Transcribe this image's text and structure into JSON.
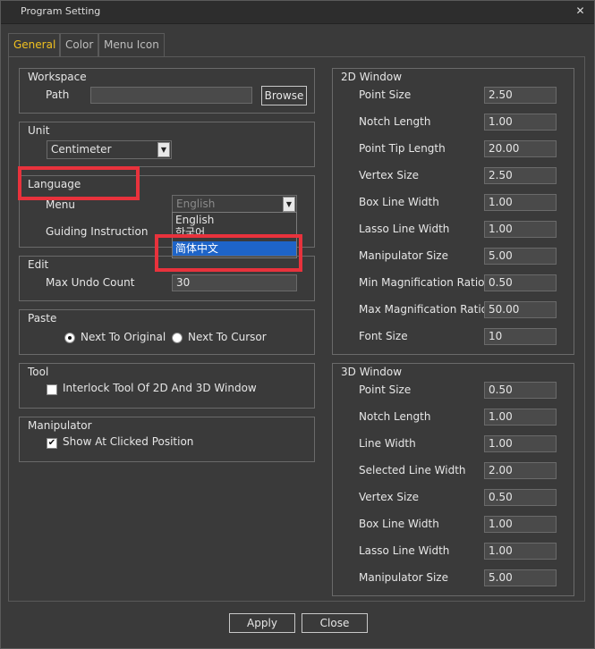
{
  "window": {
    "title": "Program Setting",
    "close_glyph": "✕"
  },
  "tabs": [
    {
      "label": "General",
      "active": true
    },
    {
      "label": "Color",
      "active": false
    },
    {
      "label": "Menu Icon",
      "active": false
    }
  ],
  "workspace": {
    "title": "Workspace",
    "path_label": "Path",
    "path_value": "",
    "browse_label": "Browse"
  },
  "unit": {
    "title": "Unit",
    "selected": "Centimeter"
  },
  "language": {
    "title": "Language",
    "menu_label": "Menu",
    "menu_selected": "English",
    "guiding_label": "Guiding Instruction",
    "dropdown_options": [
      "English",
      "한국어",
      "简体中文"
    ],
    "dropdown_selected_index": 2
  },
  "edit": {
    "title": "Edit",
    "undo_label": "Max Undo Count",
    "undo_value": "30"
  },
  "paste": {
    "title": "Paste",
    "option_original": "Next To Original",
    "option_cursor": "Next To Cursor",
    "selected": "Next To Original"
  },
  "tool": {
    "title": "Tool",
    "interlock_label": "Interlock Tool Of 2D And 3D Window",
    "interlock_checked": false
  },
  "manipulator": {
    "title": "Manipulator",
    "show_label": "Show At Clicked Position",
    "show_checked": true,
    "check_glyph": "✔"
  },
  "window2d": {
    "title": "2D Window",
    "fields": [
      {
        "label": "Point Size",
        "value": "2.50"
      },
      {
        "label": "Notch Length",
        "value": "1.00"
      },
      {
        "label": "Point Tip Length",
        "value": "20.00"
      },
      {
        "label": "Vertex Size",
        "value": "2.50"
      },
      {
        "label": "Box Line Width",
        "value": "1.00"
      },
      {
        "label": "Lasso Line Width",
        "value": "1.00"
      },
      {
        "label": "Manipulator Size",
        "value": "5.00"
      },
      {
        "label": "Min Magnification Ratio",
        "value": "0.50"
      },
      {
        "label": "Max Magnification Ratio",
        "value": "50.00"
      },
      {
        "label": "Font Size",
        "value": "10"
      }
    ]
  },
  "window3d": {
    "title": "3D Window",
    "fields": [
      {
        "label": "Point Size",
        "value": "0.50"
      },
      {
        "label": "Notch Length",
        "value": "1.00"
      },
      {
        "label": "Line Width",
        "value": "1.00"
      },
      {
        "label": "Selected Line Width",
        "value": "2.00"
      },
      {
        "label": "Vertex Size",
        "value": "0.50"
      },
      {
        "label": "Box Line Width",
        "value": "1.00"
      },
      {
        "label": "Lasso Line Width",
        "value": "1.00"
      },
      {
        "label": "Manipulator Size",
        "value": "5.00"
      }
    ]
  },
  "footer": {
    "apply_label": "Apply",
    "close_label": "Close"
  },
  "colors": {
    "accent_tab": "#f0c020",
    "highlight": "#e8323c",
    "selection": "#1e64c8"
  },
  "icons": {
    "combo_arrow": "▼"
  }
}
